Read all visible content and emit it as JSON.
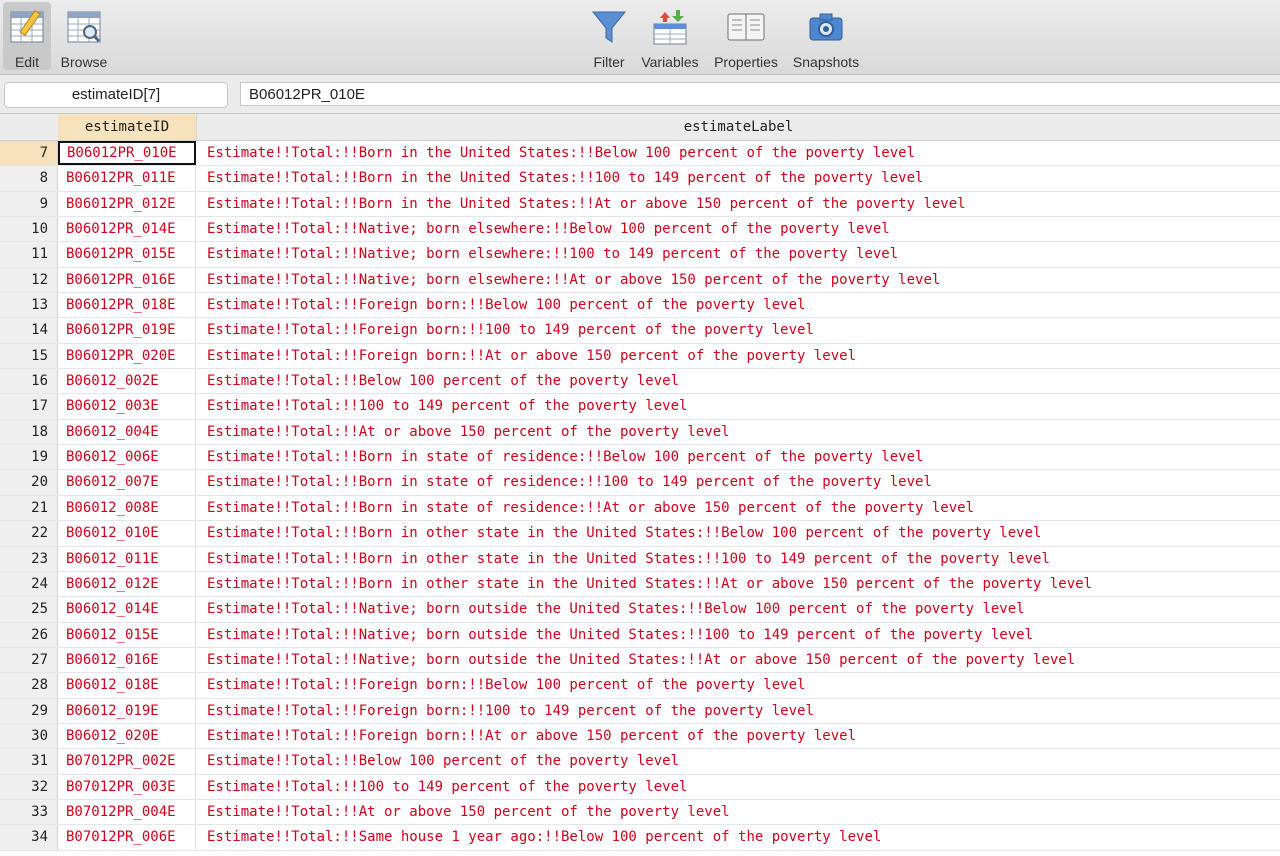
{
  "toolbar": {
    "edit": "Edit",
    "browse": "Browse",
    "filter": "Filter",
    "variables": "Variables",
    "properties": "Properties",
    "snapshots": "Snapshots"
  },
  "cellbar": {
    "reference": "estimateID[7]",
    "value": "B06012PR_010E"
  },
  "grid": {
    "columns": [
      "estimateID",
      "estimateLabel"
    ],
    "rows": [
      {
        "n": "7",
        "id": "B06012PR_010E",
        "label": "Estimate!!Total:!!Born in the United States:!!Below 100 percent of the poverty level"
      },
      {
        "n": "8",
        "id": "B06012PR_011E",
        "label": "Estimate!!Total:!!Born in the United States:!!100 to 149 percent of the poverty level"
      },
      {
        "n": "9",
        "id": "B06012PR_012E",
        "label": "Estimate!!Total:!!Born in the United States:!!At or above 150 percent of the poverty level"
      },
      {
        "n": "10",
        "id": "B06012PR_014E",
        "label": "Estimate!!Total:!!Native; born elsewhere:!!Below 100 percent of the poverty level"
      },
      {
        "n": "11",
        "id": "B06012PR_015E",
        "label": "Estimate!!Total:!!Native; born elsewhere:!!100 to 149 percent of the poverty level"
      },
      {
        "n": "12",
        "id": "B06012PR_016E",
        "label": "Estimate!!Total:!!Native; born elsewhere:!!At or above 150 percent of the poverty level"
      },
      {
        "n": "13",
        "id": "B06012PR_018E",
        "label": "Estimate!!Total:!!Foreign born:!!Below 100 percent of the poverty level"
      },
      {
        "n": "14",
        "id": "B06012PR_019E",
        "label": "Estimate!!Total:!!Foreign born:!!100 to 149 percent of the poverty level"
      },
      {
        "n": "15",
        "id": "B06012PR_020E",
        "label": "Estimate!!Total:!!Foreign born:!!At or above 150 percent of the poverty level"
      },
      {
        "n": "16",
        "id": "B06012_002E",
        "label": "Estimate!!Total:!!Below 100 percent of the poverty level"
      },
      {
        "n": "17",
        "id": "B06012_003E",
        "label": "Estimate!!Total:!!100 to 149 percent of the poverty level"
      },
      {
        "n": "18",
        "id": "B06012_004E",
        "label": "Estimate!!Total:!!At or above 150 percent of the poverty level"
      },
      {
        "n": "19",
        "id": "B06012_006E",
        "label": "Estimate!!Total:!!Born in state of residence:!!Below 100 percent of the poverty level"
      },
      {
        "n": "20",
        "id": "B06012_007E",
        "label": "Estimate!!Total:!!Born in state of residence:!!100 to 149 percent of the poverty level"
      },
      {
        "n": "21",
        "id": "B06012_008E",
        "label": "Estimate!!Total:!!Born in state of residence:!!At or above 150 percent of the poverty level"
      },
      {
        "n": "22",
        "id": "B06012_010E",
        "label": "Estimate!!Total:!!Born in other state in the United States:!!Below 100 percent of the poverty level"
      },
      {
        "n": "23",
        "id": "B06012_011E",
        "label": "Estimate!!Total:!!Born in other state in the United States:!!100 to 149 percent of the poverty level"
      },
      {
        "n": "24",
        "id": "B06012_012E",
        "label": "Estimate!!Total:!!Born in other state in the United States:!!At or above 150 percent of the poverty level"
      },
      {
        "n": "25",
        "id": "B06012_014E",
        "label": "Estimate!!Total:!!Native; born outside the United States:!!Below 100 percent of the poverty level"
      },
      {
        "n": "26",
        "id": "B06012_015E",
        "label": "Estimate!!Total:!!Native; born outside the United States:!!100 to 149 percent of the poverty level"
      },
      {
        "n": "27",
        "id": "B06012_016E",
        "label": "Estimate!!Total:!!Native; born outside the United States:!!At or above 150 percent of the poverty level"
      },
      {
        "n": "28",
        "id": "B06012_018E",
        "label": "Estimate!!Total:!!Foreign born:!!Below 100 percent of the poverty level"
      },
      {
        "n": "29",
        "id": "B06012_019E",
        "label": "Estimate!!Total:!!Foreign born:!!100 to 149 percent of the poverty level"
      },
      {
        "n": "30",
        "id": "B06012_020E",
        "label": "Estimate!!Total:!!Foreign born:!!At or above 150 percent of the poverty level"
      },
      {
        "n": "31",
        "id": "B07012PR_002E",
        "label": "Estimate!!Total:!!Below 100 percent of the poverty level"
      },
      {
        "n": "32",
        "id": "B07012PR_003E",
        "label": "Estimate!!Total:!!100 to 149 percent of the poverty level"
      },
      {
        "n": "33",
        "id": "B07012PR_004E",
        "label": "Estimate!!Total:!!At or above 150 percent of the poverty level"
      },
      {
        "n": "34",
        "id": "B07012PR_006E",
        "label": "Estimate!!Total:!!Same house 1 year ago:!!Below 100 percent of the poverty level"
      }
    ]
  },
  "colors": {
    "value_text": "#d0021b",
    "selected_header": "#f6e3bd",
    "toolbar_bg": "#dcdcdc"
  }
}
